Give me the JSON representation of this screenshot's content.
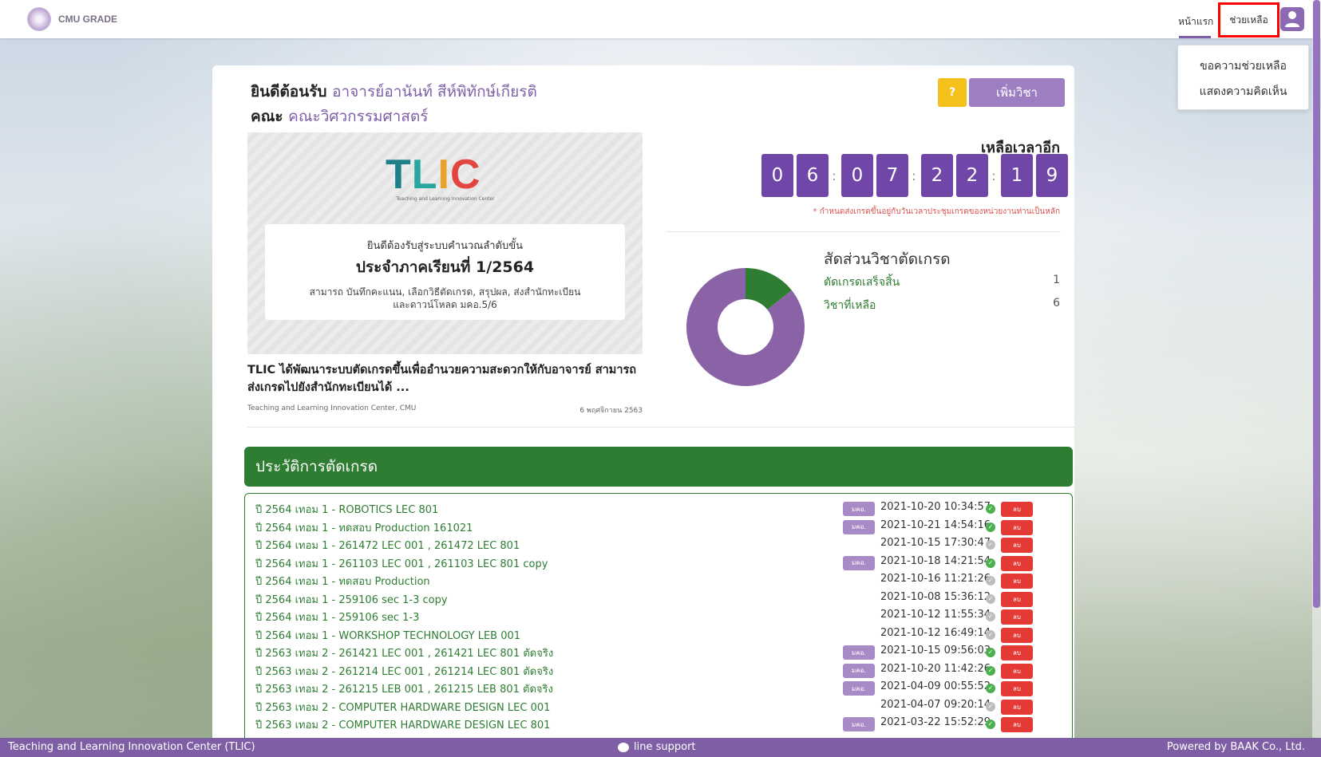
{
  "header": {
    "brand": "CMU GRADE",
    "nav_home": "หน้าแรก",
    "nav_help": "ช่วยเหลือ"
  },
  "dropdown": {
    "items": [
      "ขอความช่วยเหลือ",
      "แสดงความคิดเห็น"
    ]
  },
  "welcome": {
    "prefix": "ยินดีต้อนรับ",
    "name": "อาจารย์อานันท์ สีห์พิทักษ์เกียรติ",
    "faculty_label": "คณะ",
    "faculty": "คณะวิศวกรรมศาสตร์"
  },
  "buttons": {
    "help_q": "?",
    "add_course": "เพิ่มวิชา"
  },
  "banner": {
    "logo_letters": [
      "T",
      "L",
      "I",
      "C"
    ],
    "logo_sub": "Teaching and Learning Innovation Center",
    "line1": "ยินดีต้องรับสู่ระบบคำนวณลำดับขั้น",
    "line2": "ประจำภาคเรียนที่ 1/2564",
    "line3": "สามารถ บันทึกคะแนน, เลือกวิธีตัดเกรด, สรุปผล, ส่งสำนักทะเบียน",
    "line4": "และดาวน์โหลด มคอ.5/6"
  },
  "news": {
    "title": "TLIC ได้พัฒนาระบบตัดเกรดขึ้นเพื่ออำนวยความสะดวกให้กับอาจารย์ สามารถส่งเกรดไปยังสำนักทะเบียนได้ ...",
    "source": "Teaching and Learning Innovation Center, CMU",
    "date": "6 พฤศจิกายน 2563"
  },
  "countdown": {
    "label": "เหลือเวลาอีก",
    "digits": [
      "0",
      "6",
      "0",
      "7",
      "2",
      "2",
      "1",
      "9"
    ],
    "separator": ":",
    "note": "* กำหนดส่งเกรดขึ้นอยู่กับวันเวลาประชุมเกรดของหน่วยงานท่านเป็นหลัก"
  },
  "ratio": {
    "title": "สัดส่วนวิชาตัดเกรด",
    "done_label": "ตัดเกรดเสร็จสิ้น",
    "done_value": "1",
    "remaining_label": "วิชาที่เหลือ",
    "remaining_value": "6"
  },
  "chart_data": {
    "type": "pie",
    "categories": [
      "ตัดเกรดเสร็จสิ้น",
      "วิชาที่เหลือ"
    ],
    "values": [
      1,
      6
    ],
    "colors": [
      "#2e7d32",
      "#8a63a6"
    ]
  },
  "history": {
    "title": "ประวัติการตัดเกรด",
    "tag_label": "มคอ.",
    "delete_label": "ลบ",
    "rows": [
      {
        "label": "ปี 2564 เทอม 1 - ROBOTICS LEC 801",
        "tag": true,
        "time": "2021-10-20 10:34:57",
        "ok": true
      },
      {
        "label": "ปี 2564 เทอม 1 - ทดสอบ Production 161021",
        "tag": true,
        "time": "2021-10-21 14:54:16",
        "ok": true
      },
      {
        "label": "ปี 2564 เทอม 1 - 261472 LEC 001 , 261472 LEC 801",
        "tag": false,
        "time": "2021-10-15 17:30:47",
        "ok": false
      },
      {
        "label": "ปี 2564 เทอม 1 - 261103 LEC 001 , 261103 LEC 801 copy",
        "tag": true,
        "time": "2021-10-18 14:21:54",
        "ok": true
      },
      {
        "label": "ปี 2564 เทอม 1 - ทดสอบ Production",
        "tag": false,
        "time": "2021-10-16 11:21:26",
        "ok": false
      },
      {
        "label": "ปี 2564 เทอม 1 - 259106 sec 1-3 copy",
        "tag": false,
        "time": "2021-10-08 15:36:12",
        "ok": false
      },
      {
        "label": "ปี 2564 เทอม 1 - 259106 sec 1-3",
        "tag": false,
        "time": "2021-10-12 11:55:34",
        "ok": false
      },
      {
        "label": "ปี 2564 เทอม 1 - WORKSHOP TECHNOLOGY LEB 001",
        "tag": false,
        "time": "2021-10-12 16:49:14",
        "ok": false
      },
      {
        "label": "ปี 2563 เทอม 2 - 261421 LEC 001 , 261421 LEC 801 ตัดจริง",
        "tag": true,
        "time": "2021-10-15 09:56:03",
        "ok": true
      },
      {
        "label": "ปี 2563 เทอม 2 - 261214 LEC 001 , 261214 LEC 801 ตัดจริง",
        "tag": true,
        "time": "2021-10-20 11:42:26",
        "ok": true
      },
      {
        "label": "ปี 2563 เทอม 2 - 261215 LEB 001 , 261215 LEB 801 ตัดจริง",
        "tag": true,
        "time": "2021-04-09 00:55:52",
        "ok": true
      },
      {
        "label": "ปี 2563 เทอม 2 - COMPUTER HARDWARE DESIGN LEC 001",
        "tag": false,
        "time": "2021-04-07 09:20:14",
        "ok": false
      },
      {
        "label": "ปี 2563 เทอม 2 - COMPUTER HARDWARE DESIGN LEC 801",
        "tag": true,
        "time": "2021-03-22 15:52:29",
        "ok": true
      }
    ]
  },
  "footer": {
    "left": "Teaching and Learning Innovation Center (TLIC)",
    "middle": "line support",
    "right": "Powered by BAAK Co., Ltd."
  }
}
